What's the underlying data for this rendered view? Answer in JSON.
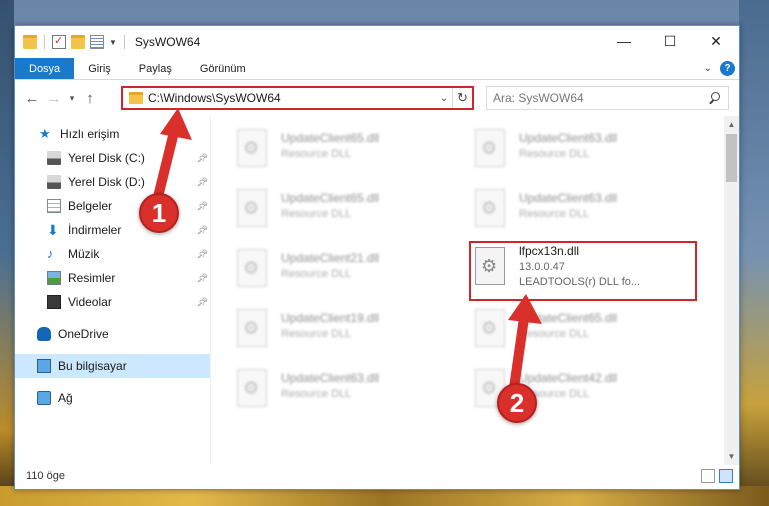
{
  "window": {
    "title": "SysWOW64",
    "controls": {
      "minimize": "—",
      "maximize": "☐",
      "close": "✕"
    }
  },
  "ribbon": {
    "tabs": [
      "Dosya",
      "Giriş",
      "Paylaş",
      "Görünüm"
    ]
  },
  "navbar": {
    "address": "C:\\Windows\\SysWOW64",
    "search_placeholder": "Ara: SysWOW64"
  },
  "sidebar": {
    "items": [
      {
        "label": "Hızlı erişim",
        "icon": "star-icon",
        "pinned": false
      },
      {
        "label": "Yerel Disk (C:)",
        "icon": "disk-icon",
        "pinned": true
      },
      {
        "label": "Yerel Disk (D:)",
        "icon": "disk-icon",
        "pinned": true
      },
      {
        "label": "Belgeler",
        "icon": "documents-icon",
        "pinned": true
      },
      {
        "label": "İndirmeler",
        "icon": "download-icon",
        "pinned": true
      },
      {
        "label": "Müzik",
        "icon": "music-icon",
        "pinned": true
      },
      {
        "label": "Resimler",
        "icon": "pictures-icon",
        "pinned": true
      },
      {
        "label": "Videolar",
        "icon": "videos-icon",
        "pinned": true
      },
      {
        "label": "OneDrive",
        "icon": "onedrive-icon",
        "pinned": false
      },
      {
        "label": "Bu bilgisayar",
        "icon": "computer-icon",
        "pinned": false,
        "selected": true
      },
      {
        "label": "Ağ",
        "icon": "network-icon",
        "pinned": false
      }
    ]
  },
  "files": [
    {
      "name": "UpdateClient65.dll",
      "type": "Resource DLL"
    },
    {
      "name": "UpdateClient63.dll",
      "type": "Resource DLL"
    },
    {
      "name": "UpdateClient65.dll",
      "type": "Resource DLL"
    },
    {
      "name": "UpdateClient63.dll",
      "type": "Resource DLL"
    },
    {
      "name": "UpdateClient21.dll",
      "type": "Resource DLL"
    },
    {
      "name": "lfpcx13n.dll",
      "version": "13.0.0.47",
      "type": "LEADTOOLS(r) DLL fo...",
      "highlighted": true
    },
    {
      "name": "UpdateClient19.dll",
      "type": "Resource DLL"
    },
    {
      "name": "UpdateClient65.dll",
      "type": "Resource DLL"
    },
    {
      "name": "UpdateClient63.dll",
      "type": "Resource DLL"
    },
    {
      "name": "UpdateClient42.dll",
      "type": "Resource DLL"
    }
  ],
  "status": {
    "count": "110 öge"
  },
  "annotations": {
    "step1": "1",
    "step2": "2",
    "color": "#d9302c"
  }
}
